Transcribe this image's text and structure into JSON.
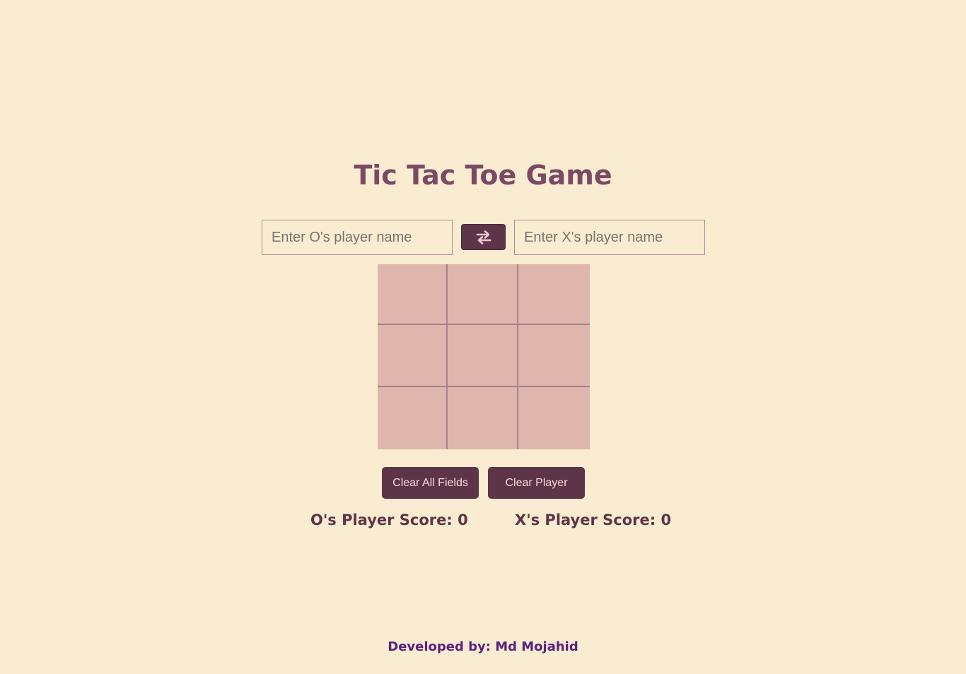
{
  "title": "Tic Tac Toe Game",
  "players": {
    "o_placeholder": "Enter O's player name",
    "x_placeholder": "Enter X's player name",
    "o_value": "",
    "x_value": "",
    "swap_icon": "swap-arrows-icon"
  },
  "board": {
    "cells": [
      "",
      "",
      "",
      "",
      "",
      "",
      "",
      "",
      ""
    ]
  },
  "buttons": {
    "clear_all": "Clear All Fields",
    "clear_player": "Clear Player"
  },
  "scores": {
    "o_label": "O's Player Score: 0",
    "x_label": "X's Player Score: 0"
  },
  "footer": "Developed by: Md Mojahid",
  "colors": {
    "background": "#f9ecd0",
    "board": "#dfb6ad",
    "grid_lines": "#a9808b",
    "button": "#5e3449",
    "title": "#7a4a65",
    "footer": "#5a2180"
  }
}
